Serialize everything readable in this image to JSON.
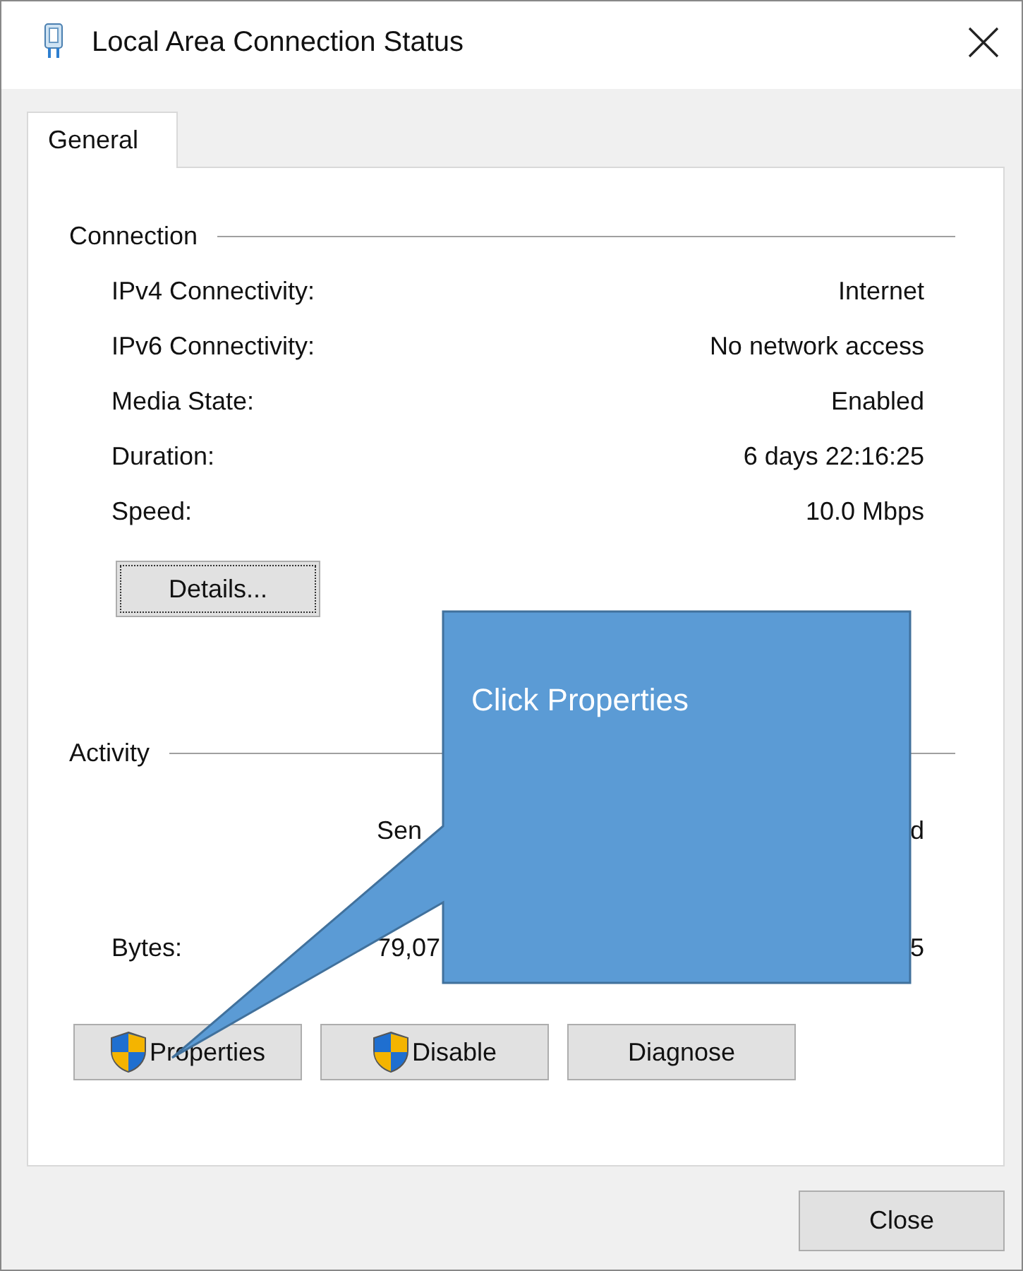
{
  "window": {
    "title": "Local Area Connection Status"
  },
  "tabs": [
    {
      "label": "General",
      "selected": true
    }
  ],
  "connection": {
    "heading": "Connection",
    "rows": [
      {
        "label": "IPv4 Connectivity:",
        "value": "Internet"
      },
      {
        "label": "IPv6 Connectivity:",
        "value": "No network access"
      },
      {
        "label": "Media State:",
        "value": "Enabled"
      },
      {
        "label": "Duration:",
        "value": "6 days 22:16:25"
      },
      {
        "label": "Speed:",
        "value": "10.0 Mbps"
      }
    ],
    "details_button": {
      "label": "Details..."
    }
  },
  "activity": {
    "heading": "Activity",
    "column_headers": [
      "Sen",
      "d"
    ],
    "rows": [
      {
        "label": "Bytes:",
        "values": [
          "79,07",
          "5"
        ]
      }
    ]
  },
  "actions": [
    {
      "label": "Properties",
      "shield": true
    },
    {
      "label": "Disable",
      "shield": true
    },
    {
      "label": "Diagnose",
      "shield": false
    }
  ],
  "close_button": {
    "label": "Close"
  },
  "callout": {
    "text": "Click Properties"
  }
}
